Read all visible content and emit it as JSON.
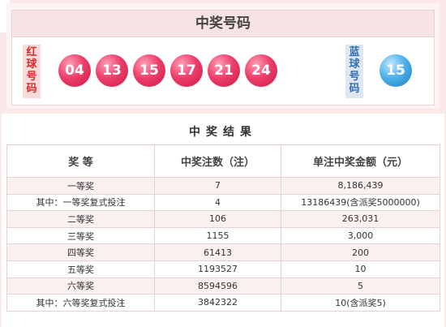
{
  "header": {
    "title": "中奖号码"
  },
  "red_label": "红球号码",
  "blue_label": "蓝球号码",
  "red_balls": [
    "04",
    "13",
    "15",
    "17",
    "21",
    "24"
  ],
  "blue_ball": "15",
  "colors": {
    "red_ball": "#e8385f",
    "blue_ball": "#3aa3e0",
    "red_text": "#d62a2a",
    "blue_text": "#2f6fb1"
  },
  "results": {
    "title": "中奖结果",
    "columns": [
      "奖 等",
      "中奖注数（注）",
      "单注中奖金额（元）"
    ],
    "rows": [
      [
        "一等奖",
        "7",
        "8,186,439"
      ],
      [
        "其中：一等奖复式投注",
        "4",
        "13186439(含派奖5000000)"
      ],
      [
        "二等奖",
        "106",
        "263,031"
      ],
      [
        "三等奖",
        "1155",
        "3,000"
      ],
      [
        "四等奖",
        "61413",
        "200"
      ],
      [
        "五等奖",
        "1193527",
        "10"
      ],
      [
        "六等奖",
        "8594596",
        "5"
      ],
      [
        "其中：六等奖复式投注",
        "3842322",
        "10(含派奖5)"
      ]
    ]
  }
}
